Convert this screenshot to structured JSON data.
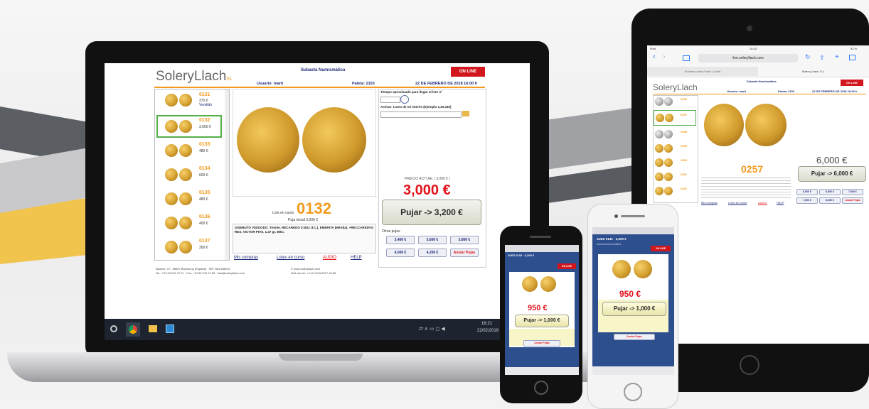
{
  "palette": {
    "brand_gold": "#f39a1e",
    "price_red": "#e2141c",
    "navy": "#1c2a7a",
    "online_red": "#d1161d"
  },
  "laptop": {
    "title": "Subasta Numismática",
    "brand_main": "SoleryLlach",
    "brand_suffix": "SL",
    "online_badge": "ON LINE",
    "user": "Usuario: marti",
    "paddle": "Paleta: 2103",
    "date": "22 DE FEBRERO DE 2018 16:00 h",
    "time_label": "Tiempo aproximado para llegar al lote nº",
    "activate_label": "Activar: Lotes de mi interés (Ejemplo 1,20,330)",
    "lots": [
      {
        "num": "0131",
        "price": "375 €",
        "note": "Vendido"
      },
      {
        "num": "0132",
        "price": "3,000 €",
        "note": ""
      },
      {
        "num": "0133",
        "price": "480 €",
        "note": ""
      },
      {
        "num": "0134",
        "price": "600 €",
        "note": ""
      },
      {
        "num": "0135",
        "price": "480 €",
        "note": ""
      },
      {
        "num": "0136",
        "price": "400 €",
        "note": ""
      },
      {
        "num": "0137",
        "price": "300 €",
        "note": ""
      }
    ],
    "current_lot_label": "Lote en curso",
    "current_lot": "0132",
    "starting_price": "Puja inicial 3,000 €",
    "description": "SISEBUTO VISIGODO. Triente. RECAREDO II (621 d.C.). EMERITA (Mérida). +RECCAREDVS REX, VICTOR PIVS. 1,47 gr. EBC.",
    "precio_label": "PRECIO ACTUAL ( 3,000 € )",
    "current_price": "3,000 €",
    "bid_button": "Pujar -> 3,200 €",
    "other_bids_label": "Otras pujas",
    "other_bids": [
      "3,400 €",
      "3,600 €",
      "3,800 €",
      "4,000 €",
      "4,200 €",
      "Anular Pujas"
    ],
    "links": [
      "Mis compras",
      "Lotes en curso",
      "AUDIO",
      "HELP"
    ],
    "footer_left": "Balmes, 72 - 08007 Barcelona (España) · NIF: B61308203",
    "footer_left2": "Tel.: +34 93 215 47 21 · Fax: +34 93 215 13 08 · info@soleryllach.com",
    "footer_right": "© www.soleryllach.com",
    "footer_right2": "Web server: v 1.0 01/11/2017 16:48"
  },
  "taskbar": {
    "time": "16:21",
    "date": "22/02/2018"
  },
  "tablet": {
    "status_left": "iPad",
    "status_center": "10:43",
    "status_right": "92 %",
    "url": "live.soleryllach.com",
    "tab_left": "Subasta online Soler y Llach",
    "tab_right": "Soler y Llach, S.L.",
    "title": "Subasta Numismática",
    "brand_main": "SoleryLlach",
    "user": "Usuario: marti",
    "paddle": "Paleta: 2103",
    "date": "22 DE FEBRERO DE 2018 16:00 h",
    "lots": [
      "0256",
      "0257",
      "0258",
      "0259",
      "0260",
      "0261",
      "0262"
    ],
    "current_lot": "0257",
    "current_price": "6,000 €",
    "bid_button": "Pujar -> 6,000 €",
    "other_bids": [
      "6,000 €",
      "6,500 €",
      "7,000 €",
      "7,500 €",
      "8,000 €",
      "Anular Pujas"
    ],
    "links": [
      "Mis compras",
      "Lotes en curso",
      "AUDIO",
      "HELP"
    ]
  },
  "phone_dark": {
    "header": "JUEZ 0132 · 3,200 €",
    "online_badge": "ON LINE",
    "price": "950 €",
    "bid_button": "Pujar -> 1,000 €",
    "cancel": "Anular Pujas"
  },
  "phone_white": {
    "header": "JUEZ 0132 · 3,200 €",
    "subtitle": "Subasta Numismática",
    "online_badge": "ON LINE",
    "price": "950 €",
    "bid_button": "Pujar -> 1,000 €",
    "cancel": "Anular Pujas"
  }
}
